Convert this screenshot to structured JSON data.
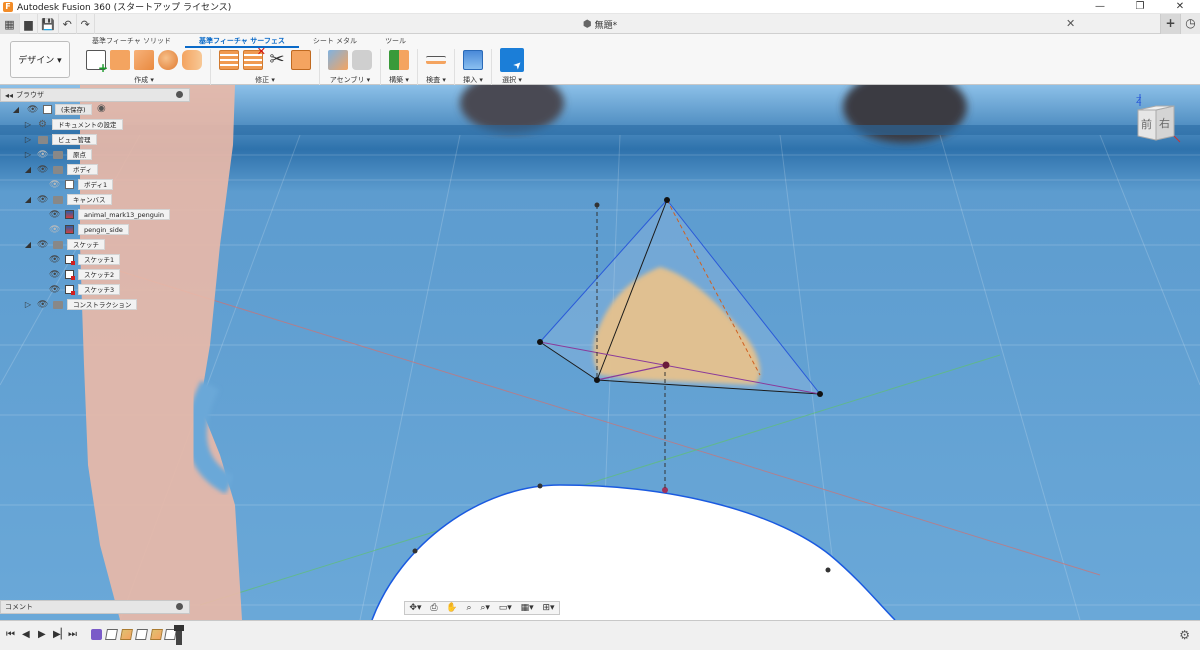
{
  "window": {
    "title": "Autodesk Fusion 360 (スタートアップ ライセンス)",
    "minimize": "—",
    "restore": "❐",
    "close": "✕"
  },
  "quick_access": {
    "grid_icon": "▦",
    "file_icon": "▆",
    "save_icon": "💾",
    "undo_icon": "↶",
    "redo_icon": "↷",
    "document_title": "無題*",
    "close_tab": "✕",
    "new_tab": "+",
    "jobs_icon": "◷"
  },
  "ribbon": {
    "workspace": "デザイン ▾",
    "tabs": [
      {
        "label": "基準フィーチャ ソリッド",
        "active": false
      },
      {
        "label": "基準フィーチャ サーフェス",
        "active": true
      },
      {
        "label": "シート メタル",
        "active": false
      },
      {
        "label": "ツール",
        "active": false
      }
    ],
    "groups": {
      "create": "作成 ▾",
      "modify": "修正 ▾",
      "assemble": "アセンブリ ▾",
      "construct": "構築 ▾",
      "inspect": "検査 ▾",
      "insert": "挿入 ▾",
      "select": "選択 ▾"
    }
  },
  "browser": {
    "title": "ブラウザ",
    "items": [
      {
        "label": "(未保存)"
      },
      {
        "label": "ドキュメントの設定"
      },
      {
        "label": "ビュー管理"
      },
      {
        "label": "原点"
      },
      {
        "label": "ボディ"
      },
      {
        "label": "ボディ1"
      },
      {
        "label": "キャンバス"
      },
      {
        "label": "animal_mark13_penguin"
      },
      {
        "label": "pengin_side"
      },
      {
        "label": "スケッチ"
      },
      {
        "label": "スケッチ1"
      },
      {
        "label": "スケッチ2"
      },
      {
        "label": "スケッチ3"
      },
      {
        "label": "コンストラクション"
      }
    ]
  },
  "comment": {
    "title": "コメント"
  },
  "viewcube": {
    "front": "前",
    "right": "右",
    "z": "Z"
  },
  "colors": {
    "accent": "#0a6ac8",
    "sky": "#7fb8e4",
    "canvas_orange": "#f8c070",
    "penguin_skin": "#e8b8a8"
  }
}
